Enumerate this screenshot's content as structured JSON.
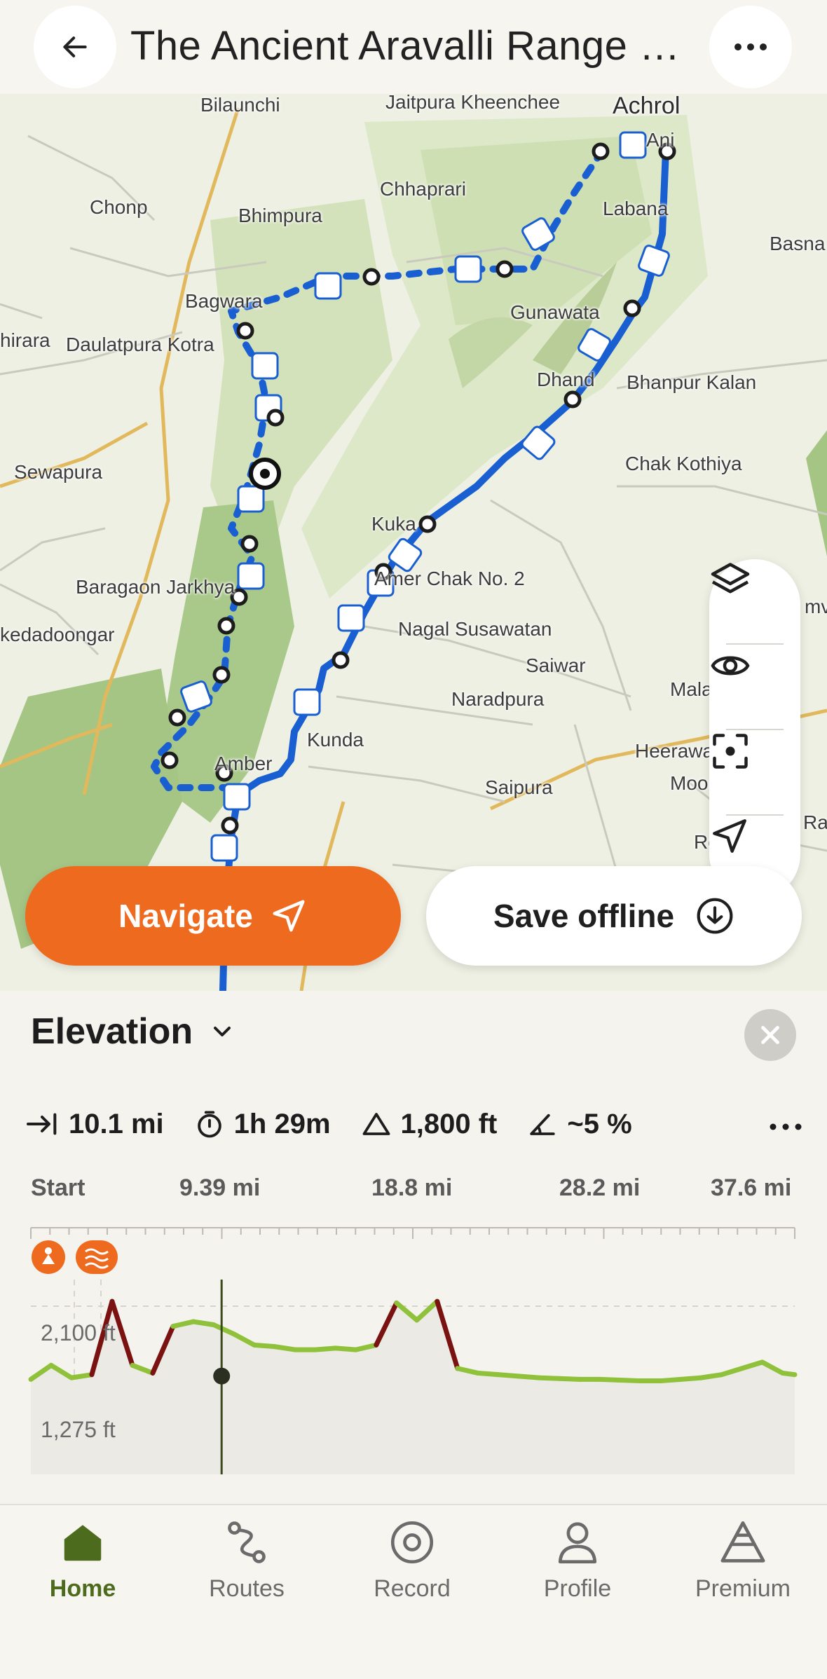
{
  "header": {
    "title": "The Ancient Aravalli Range o..."
  },
  "map": {
    "places": [
      {
        "name": "Bilaunchi"
      },
      {
        "name": "Jaitpura Kheenchee"
      },
      {
        "name": "Achrol"
      },
      {
        "name": "Ani"
      },
      {
        "name": "Chonp"
      },
      {
        "name": "Bhimpura"
      },
      {
        "name": "Chhaprari"
      },
      {
        "name": "Labana"
      },
      {
        "name": "Basna"
      },
      {
        "name": "Bagwara"
      },
      {
        "name": "Gunawata"
      },
      {
        "name": "hirara"
      },
      {
        "name": "Daulatpura Kotra"
      },
      {
        "name": "Dhand"
      },
      {
        "name": "Bhanpur Kalan"
      },
      {
        "name": "Sewapura"
      },
      {
        "name": "Chak Kothiya"
      },
      {
        "name": "Kuka"
      },
      {
        "name": "Baragaon Jarkhya"
      },
      {
        "name": "Amer Chak No. 2"
      },
      {
        "name": "kedadoongar"
      },
      {
        "name": "Nagal Susawatan"
      },
      {
        "name": "Saiwar"
      },
      {
        "name": "Naradpura"
      },
      {
        "name": "Mala"
      },
      {
        "name": "Kunda"
      },
      {
        "name": "Heerawa"
      },
      {
        "name": "Amber"
      },
      {
        "name": "Saipura"
      },
      {
        "name": "Moor"
      },
      {
        "name": "Roopwas"
      },
      {
        "name": "Ra"
      },
      {
        "name": "mv"
      }
    ],
    "tools": {
      "layers_icon": "layers-icon",
      "visibility_icon": "eye-icon",
      "recenter_icon": "focus-icon",
      "location_icon": "location-arrow-icon"
    },
    "route_color": "#1a5fd1"
  },
  "actions": {
    "navigate_label": "Navigate",
    "save_offline_label": "Save offline",
    "navigate_color": "#ee6a1f"
  },
  "elevation": {
    "title": "Elevation",
    "stats": {
      "distance": "10.1 mi",
      "duration": "1h 29m",
      "gain": "1,800 ft",
      "grade": "~5 %"
    },
    "chart_data": {
      "type": "line",
      "title": "",
      "x_ticks": [
        "Start",
        "9.39 mi",
        "18.8 mi",
        "28.2 mi",
        "37.6 mi"
      ],
      "y_ticks": [
        "2,100 ft",
        "1,275 ft"
      ],
      "xlim": [
        0,
        37.6
      ],
      "ylim": [
        1000,
        2250
      ],
      "x": [
        0,
        1,
        2,
        3,
        4,
        5,
        6,
        7,
        8,
        9,
        10,
        11,
        12,
        13,
        14,
        15,
        16,
        17,
        18,
        19,
        20,
        21,
        22,
        23,
        24,
        25,
        26,
        27,
        28,
        29,
        30,
        31,
        32,
        33,
        34,
        35,
        36,
        37,
        37.6
      ],
      "y": [
        1610,
        1700,
        1620,
        1640,
        2110,
        1700,
        1650,
        1950,
        1980,
        1960,
        1900,
        1830,
        1820,
        1800,
        1800,
        1810,
        1800,
        1830,
        2100,
        1990,
        2110,
        1680,
        1650,
        1640,
        1630,
        1620,
        1615,
        1610,
        1610,
        1605,
        1600,
        1600,
        1610,
        1620,
        1640,
        1680,
        1720,
        1650,
        1640
      ],
      "marker_x": 9.39,
      "line_color_low_grade": "#8fc23a",
      "line_color_high_grade": "#7a1212"
    }
  },
  "tabs": [
    {
      "label": "Home",
      "icon": "home-icon",
      "active": true
    },
    {
      "label": "Routes",
      "icon": "routes-icon",
      "active": false
    },
    {
      "label": "Record",
      "icon": "record-icon",
      "active": false
    },
    {
      "label": "Profile",
      "icon": "profile-icon",
      "active": false
    },
    {
      "label": "Premium",
      "icon": "premium-icon",
      "active": false
    }
  ]
}
